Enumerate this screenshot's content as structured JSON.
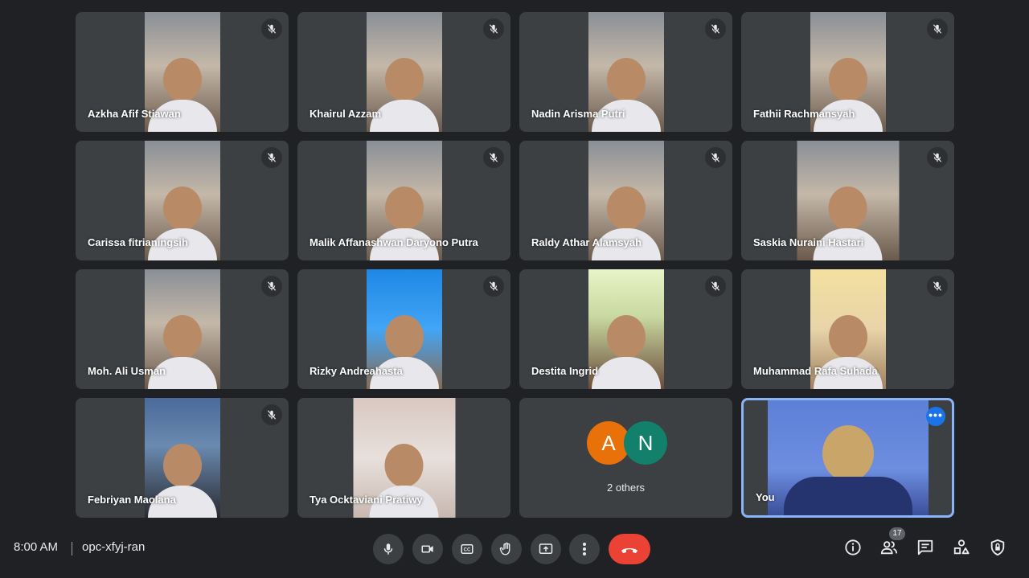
{
  "participants": [
    {
      "name": "Azkha Afif Stiawan"
    },
    {
      "name": "Khairul Azzam"
    },
    {
      "name": "Nadin Arisma Putri"
    },
    {
      "name": "Fathii Rachmansyah"
    },
    {
      "name": "Carissa fitrianingsih"
    },
    {
      "name": "Malik Affanashwan Daryono Putra"
    },
    {
      "name": "Raldy Athar Alamsyah"
    },
    {
      "name": "Saskia Nuraini Hastari"
    },
    {
      "name": "Moh. Ali Usman"
    },
    {
      "name": "Rizky Andreahasta"
    },
    {
      "name": "Destita Ingrid"
    },
    {
      "name": "Muhammad Rafa Suhada"
    },
    {
      "name": "Febriyan Maolana"
    },
    {
      "name": "Tya Ocktaviani Pratiwy"
    }
  ],
  "others_tile": {
    "avatars": [
      {
        "letter": "A",
        "color": "#e8710a"
      },
      {
        "letter": "N",
        "color": "#12806a"
      }
    ],
    "label": "2 others"
  },
  "self_tile": {
    "name": "You",
    "more_icon": "•••"
  },
  "bottom_bar": {
    "time": "8:00 AM",
    "meeting_code": "opc-xfyj-ran",
    "participant_count": "17"
  },
  "colors": {
    "background": "#202124",
    "tile": "#3c4043",
    "end_call": "#ea4335",
    "self_border": "#8ab4f8"
  }
}
